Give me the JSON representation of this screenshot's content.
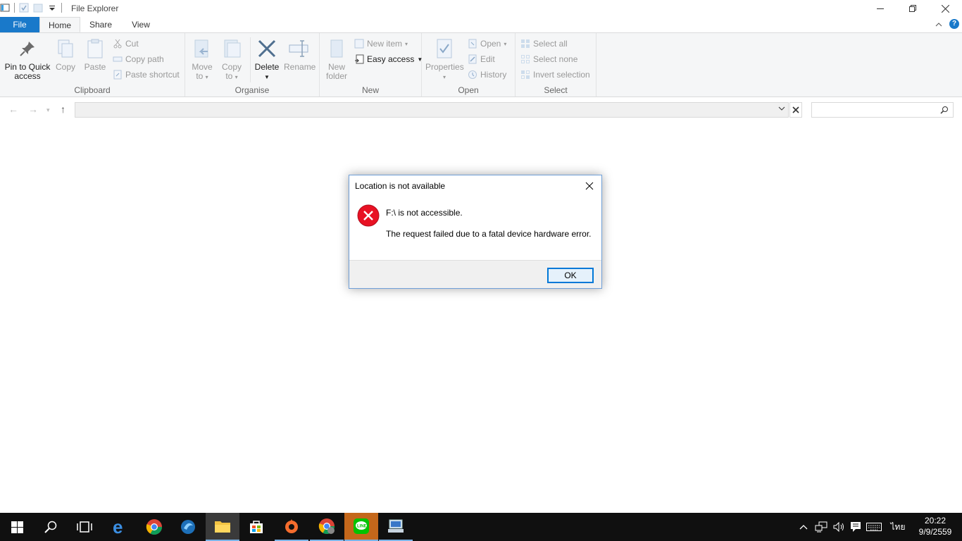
{
  "window": {
    "title": "File Explorer"
  },
  "tabs": {
    "file": "File",
    "home": "Home",
    "share": "Share",
    "view": "View"
  },
  "ribbon": {
    "clipboard": {
      "group": "Clipboard",
      "pin_line1": "Pin to Quick",
      "pin_line2": "access",
      "copy": "Copy",
      "paste": "Paste",
      "cut": "Cut",
      "copy_path": "Copy path",
      "paste_shortcut": "Paste shortcut"
    },
    "organise": {
      "group": "Organise",
      "move_line1": "Move",
      "move_line2": "to",
      "copy_line1": "Copy",
      "copy_line2": "to",
      "delete": "Delete",
      "rename": "Rename"
    },
    "new": {
      "group": "New",
      "folder_line1": "New",
      "folder_line2": "folder",
      "new_item": "New item",
      "easy_access": "Easy access"
    },
    "open": {
      "group": "Open",
      "properties": "Properties",
      "open": "Open",
      "edit": "Edit",
      "history": "History"
    },
    "select": {
      "group": "Select",
      "select_all": "Select all",
      "select_none": "Select none",
      "invert": "Invert selection"
    }
  },
  "dialog": {
    "title": "Location is not available",
    "message": "F:\\ is not accessible.",
    "detail": "The request failed due to a fatal device hardware error.",
    "ok": "OK"
  },
  "taskbar": {
    "time": "20:22",
    "date": "9/9/2559",
    "language": "ไทย"
  },
  "colors": {
    "accent": "#1979ca",
    "error": "#e81123",
    "taskbar": "#101010"
  }
}
